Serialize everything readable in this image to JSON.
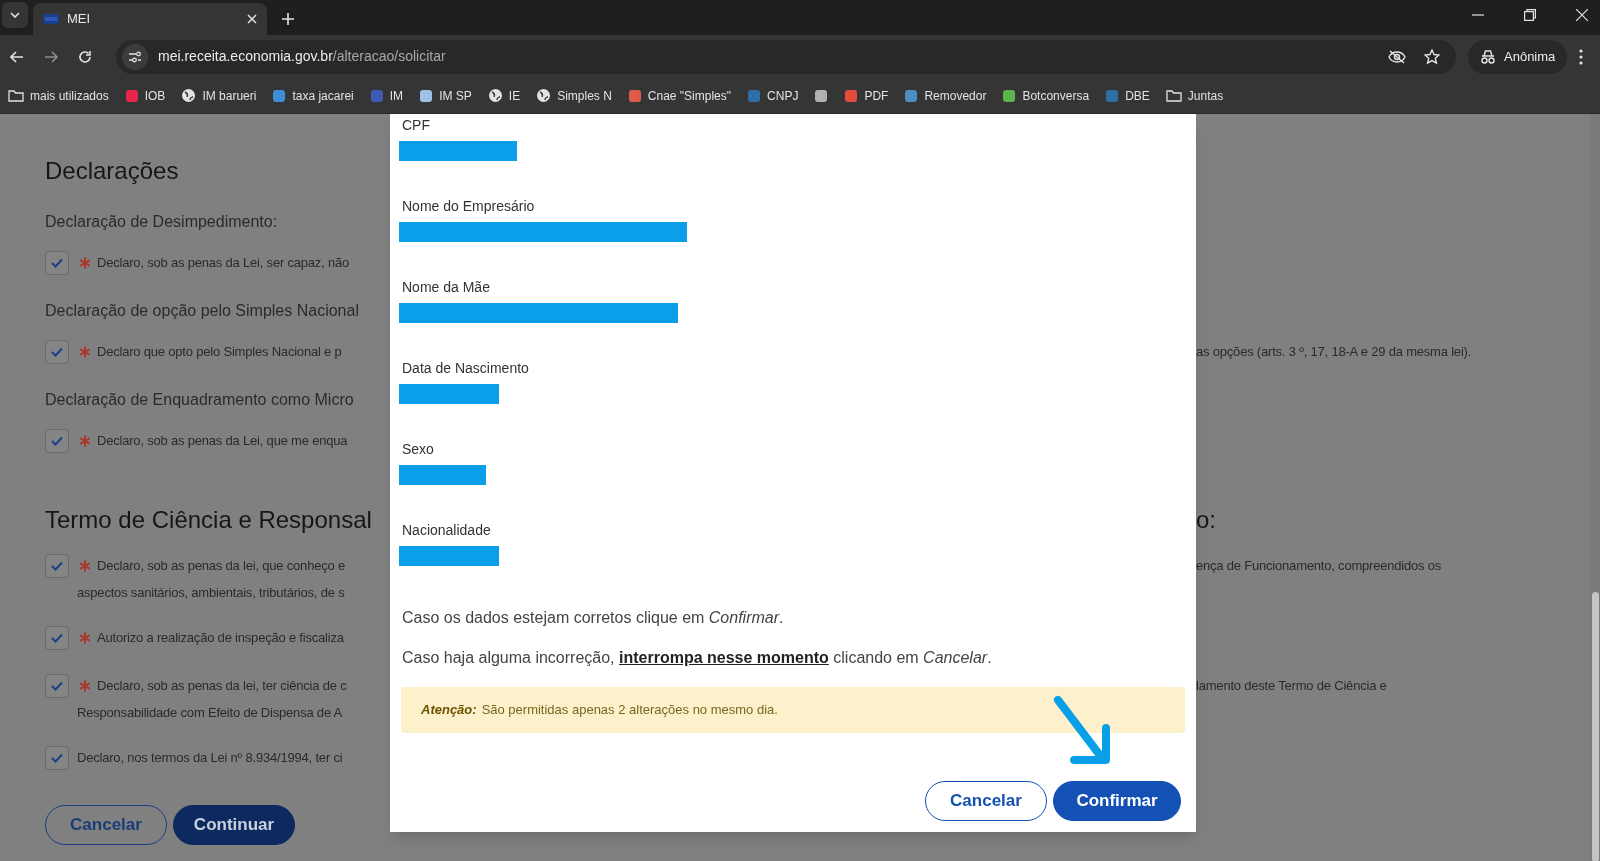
{
  "browser": {
    "tab": {
      "title": "MEI",
      "selected": true
    },
    "url_host": "mei.receita.economia.gov.br",
    "url_path": "/alteracao/solicitar",
    "profile": "Anônima",
    "bookmarks": [
      {
        "kind": "folder",
        "label": "mais utilizados"
      },
      {
        "kind": "favicon",
        "label": "IOB",
        "color": "#e8234a"
      },
      {
        "kind": "globe",
        "label": "IM barueri"
      },
      {
        "kind": "favicon",
        "label": "taxa jacarei",
        "color": "#3a8fd6"
      },
      {
        "kind": "favicon",
        "label": "IM",
        "color": "#3b5bb5"
      },
      {
        "kind": "favicon",
        "label": "IM SP",
        "color": "#9cc3e6"
      },
      {
        "kind": "globe",
        "label": "IE"
      },
      {
        "kind": "globe",
        "label": "Simples N"
      },
      {
        "kind": "favicon",
        "label": "Cnae \"Simples\"",
        "color": "#e0584a"
      },
      {
        "kind": "favicon",
        "label": "CNPJ",
        "color": "#2f6fa8"
      },
      {
        "kind": "favicon",
        "color": "#b0b0b0"
      },
      {
        "kind": "favicon",
        "label": "PDF",
        "color": "#e64a3c"
      },
      {
        "kind": "favicon",
        "label": "Removedor",
        "color": "#4a8cc4"
      },
      {
        "kind": "favicon",
        "label": "Botconversa",
        "color": "#5bb34a"
      },
      {
        "kind": "favicon",
        "label": "DBE",
        "color": "#2f6fa8"
      },
      {
        "kind": "folder",
        "label": "Juntas"
      }
    ]
  },
  "page": {
    "items": [
      {
        "kind": "heading",
        "lines": [
          {
            "left": "Declarações"
          }
        ]
      },
      {
        "kind": "subheading",
        "lines": [
          {
            "left": "Declaração de Desimpedimento:"
          }
        ]
      },
      {
        "kind": "check",
        "checked": true,
        "required": true,
        "lines": [
          {
            "left": "Declaro, sob as penas da Lei, ser capaz, não"
          }
        ]
      },
      {
        "kind": "subheading",
        "lines": [
          {
            "left": "Declaração de opção pelo Simples Nacional"
          }
        ]
      },
      {
        "kind": "check",
        "checked": true,
        "required": true,
        "lines": [
          {
            "left": "Declaro que opto pelo Simples Nacional e p",
            "right": "as opções (arts. 3 º, 17, 18-A e 29 da mesma lei)."
          }
        ]
      },
      {
        "kind": "subheading",
        "lines": [
          {
            "left": "Declaração de Enquadramento como Micro"
          }
        ]
      },
      {
        "kind": "check",
        "checked": true,
        "required": true,
        "lines": [
          {
            "left": "Declaro, sob as penas da Lei, que me enqua"
          }
        ]
      },
      {
        "kind": "heading",
        "lines": [
          {
            "left": "Termo de Ciência e Responsal",
            "right": "o:"
          }
        ]
      },
      {
        "kind": "check",
        "checked": true,
        "required": true,
        "lines": [
          {
            "left": "Declaro, sob as penas da lei, que conheço e",
            "right": "ença de Funcionamento, compreendidos os"
          },
          {
            "left": "aspectos sanitários, ambientais, tributários, de s"
          }
        ]
      },
      {
        "kind": "check",
        "checked": true,
        "required": true,
        "lines": [
          {
            "left": "Autorizo a realização de inspeção e fiscaliza"
          }
        ]
      },
      {
        "kind": "check",
        "checked": true,
        "required": true,
        "lines": [
          {
            "left": "Declaro, sob as penas da lei, ter ciência de c",
            "right": "lamento deste Termo de Ciência e"
          },
          {
            "left": "Responsabilidade com Efeito de Dispensa de A"
          }
        ]
      },
      {
        "kind": "check",
        "checked": true,
        "required": false,
        "lines": [
          {
            "left": "Declaro, nos termos da Lei nº 8.934/1994, ter ci"
          }
        ]
      }
    ],
    "buttons": [
      {
        "kind": "secondary",
        "label": "Cancelar"
      },
      {
        "kind": "primary",
        "label": "Continuar"
      }
    ]
  },
  "dialog": {
    "fields": [
      {
        "label": "CPF",
        "redacted": true
      },
      {
        "label": "Nome do Empresário",
        "redacted": true
      },
      {
        "label": "Nome da Mãe",
        "redacted": true
      },
      {
        "label": "Data de Nascimento",
        "redacted": true
      },
      {
        "label": "Sexo",
        "redacted": true
      },
      {
        "label": "Nacionalidade",
        "redacted": true
      }
    ],
    "messages": [
      "Caso os dados estejam corretos clique em *Confirmar*.",
      "Caso haja alguma incorreção, **interrompa nesse momento** clicando em *Cancelar*."
    ],
    "alert": {
      "label": "Atenção:",
      "text": "São permitidas apenas 2 alterações no mesmo dia."
    },
    "pointer_arrow": true,
    "buttons": [
      {
        "kind": "secondary",
        "label": "Cancelar"
      },
      {
        "kind": "primary",
        "label": "Confirmar"
      }
    ]
  }
}
